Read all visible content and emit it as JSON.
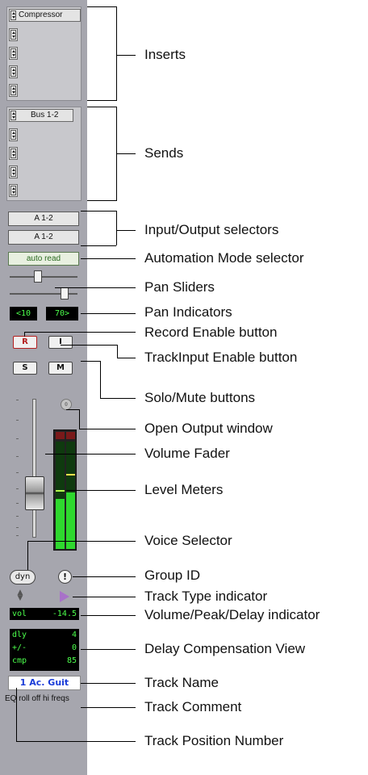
{
  "strip": {
    "inserts": [
      "Compressor",
      "",
      "",
      "",
      ""
    ],
    "sends": [
      "Bus 1-2",
      "",
      "",
      "",
      ""
    ],
    "input_selector": "A 1-2",
    "output_selector": "A 1-2",
    "automation_mode": "auto read",
    "pan_left": "<10",
    "pan_right": "70>",
    "record_label": "R",
    "input_label": "I",
    "solo_label": "S",
    "mute_label": "M",
    "voice_label": "dyn",
    "group_id_label": "!",
    "vol_label": "vol",
    "vol_value": "-14.5",
    "delay": [
      {
        "label": "dly",
        "value": "4"
      },
      {
        "label": "+/-",
        "value": "0"
      },
      {
        "label": "cmp",
        "value": "85"
      }
    ],
    "track_name": "1 Ac. Guit",
    "track_comment": "EQ roll off hi freqs",
    "colors": {
      "strip_bg": "#a6a6ae",
      "meter_green": "#2ed82e",
      "record_red": "#b41e1e",
      "lcd_green": "#4cff4c",
      "name_blue": "#1a3cd8"
    }
  },
  "callouts": {
    "inserts": "Inserts",
    "sends": "Sends",
    "io": "Input/Output selectors",
    "automation": "Automation Mode selector",
    "pan_sliders": "Pan Sliders",
    "pan_indicators": "Pan Indicators",
    "record": "Record Enable button",
    "track_input": "TrackInput Enable button",
    "solo_mute": "Solo/Mute buttons",
    "output_window": "Open Output window",
    "volume_fader": "Volume Fader",
    "level_meters": "Level Meters",
    "voice": "Voice Selector",
    "group_id": "Group ID",
    "track_type": "Track Type indicator",
    "vol_peak": "Volume/Peak/Delay indicator",
    "delay_comp": "Delay Compensation View",
    "track_name": "Track Name",
    "track_comment": "Track Comment",
    "track_position": "Track Position Number"
  }
}
